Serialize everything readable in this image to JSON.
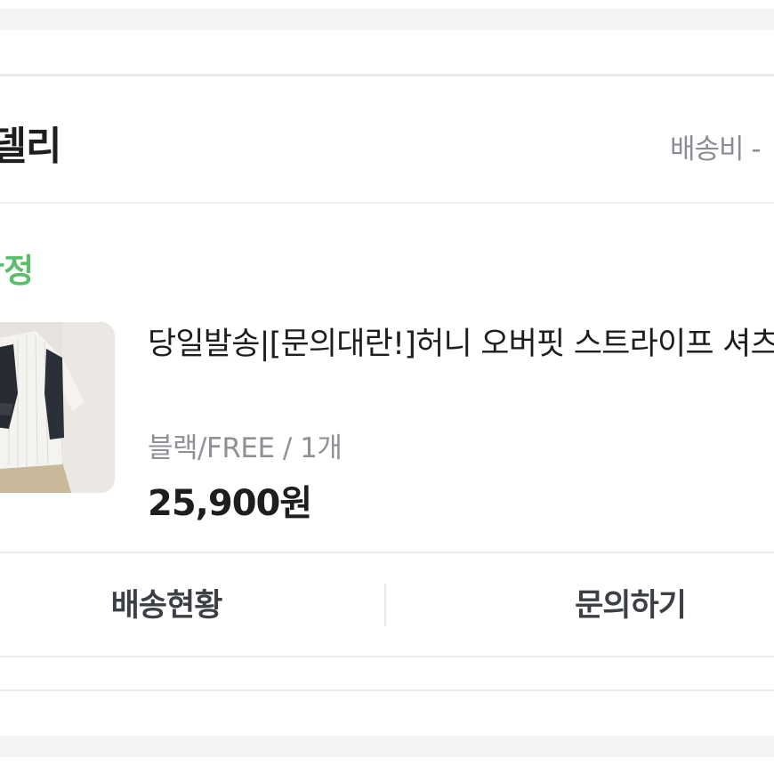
{
  "store": {
    "name": "이델리",
    "shipping_fee_label": "배송비 -"
  },
  "order": {
    "status": "구매확정"
  },
  "product": {
    "image_alt": "product-photo",
    "title": "당일발송|[문의대란!]허니 오버핏 스트라이프 셔츠",
    "option": "블랙/FREE / 1개",
    "price": "25,900원"
  },
  "actions": {
    "shipping_status_label": "배송현황",
    "inquiry_label": "문의하기"
  },
  "colors": {
    "status_green": "#5bbf6a",
    "text_dark": "#1e1e1e",
    "text_gray": "#8a8d93",
    "divider": "#e9eaec",
    "band": "#f3f4f6"
  }
}
